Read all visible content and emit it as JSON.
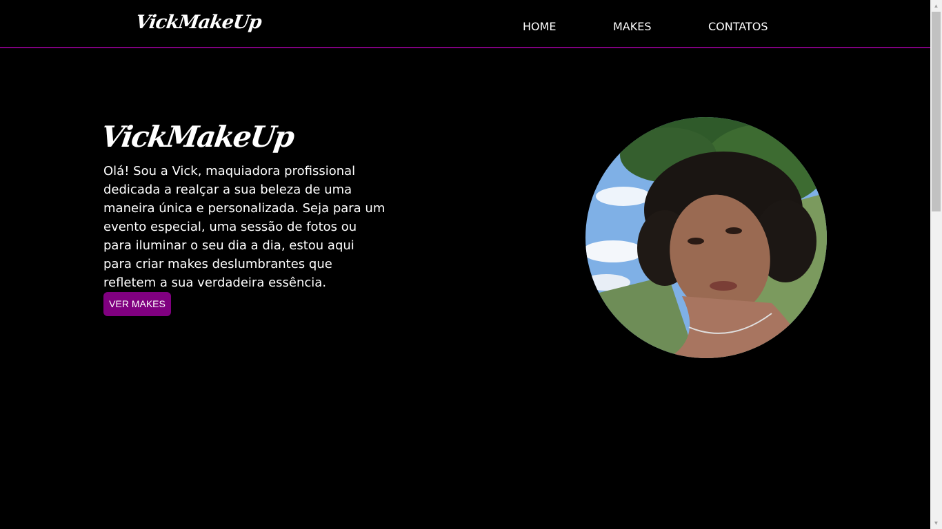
{
  "header": {
    "logo": "VickMakeUp",
    "nav": [
      {
        "label": "HOME"
      },
      {
        "label": "MAKES"
      },
      {
        "label": "CONTATOS"
      }
    ]
  },
  "hero": {
    "title": "VickMakeUp",
    "text": "Olá! Sou a Vick, maquiadora profissional dedicada a realçar a sua beleza de uma maneira única e personalizada. Seja para um evento especial, uma sessão de fotos ou para iluminar o seu dia a dia, estou aqui para criar makes deslumbrantes que refletem a sua verdadeira essência.",
    "button_label": "VER MAKES"
  },
  "colors": {
    "background": "#000000",
    "accent": "#800080",
    "text": "#ffffff"
  },
  "icons": {
    "scroll_up": "scroll-up-arrow-icon",
    "scroll_down": "scroll-down-arrow-icon"
  }
}
